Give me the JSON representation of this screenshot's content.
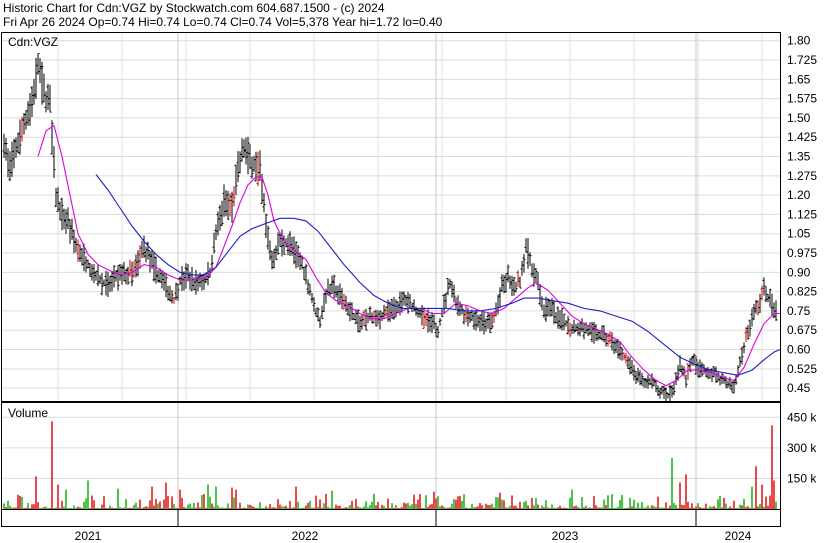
{
  "header": {
    "line1": "Historic Chart for Cdn:VGZ by Stockwatch.com 604.687.1500 - (c) 2024",
    "line2": "Fri Apr 26 2024  Op=0.74  Hi=0.74  Lo=0.74  Cl=0.74  Vol=5,378  Year hi=1.72  lo=0.40"
  },
  "chart_data": [
    {
      "type": "ohlc",
      "title": "Cdn:VGZ",
      "ylim": [
        0.4,
        1.83
      ],
      "yticks": [
        "1.80",
        "1.725",
        "1.65",
        "1.575",
        "1.50",
        "1.425",
        "1.35",
        "1.275",
        "1.20",
        "1.125",
        "1.05",
        "0.975",
        "0.90",
        "0.825",
        "0.75",
        "0.675",
        "0.60",
        "0.525",
        "0.45"
      ],
      "x_labels": [
        "2021",
        "2022",
        "2023",
        "2024"
      ],
      "grid": true,
      "price_anchors": [
        [
          0,
          1.42
        ],
        [
          5,
          1.3
        ],
        [
          10,
          1.36
        ],
        [
          16,
          1.43
        ],
        [
          22,
          1.5
        ],
        [
          28,
          1.57
        ],
        [
          34,
          1.7
        ],
        [
          40,
          1.6
        ],
        [
          46,
          1.55
        ],
        [
          52,
          1.2
        ],
        [
          58,
          1.13
        ],
        [
          64,
          1.1
        ],
        [
          72,
          1.0
        ],
        [
          80,
          0.96
        ],
        [
          88,
          0.91
        ],
        [
          96,
          0.87
        ],
        [
          104,
          0.85
        ],
        [
          112,
          0.88
        ],
        [
          120,
          0.89
        ],
        [
          130,
          0.9
        ],
        [
          140,
          1.0
        ],
        [
          150,
          0.92
        ],
        [
          158,
          0.87
        ],
        [
          166,
          0.82
        ],
        [
          170,
          0.79
        ],
        [
          176,
          0.87
        ],
        [
          184,
          0.89
        ],
        [
          192,
          0.86
        ],
        [
          200,
          0.87
        ],
        [
          206,
          0.9
        ],
        [
          212,
          1.05
        ],
        [
          220,
          1.18
        ],
        [
          228,
          1.16
        ],
        [
          234,
          1.3
        ],
        [
          240,
          1.38
        ],
        [
          248,
          1.33
        ],
        [
          256,
          1.3
        ],
        [
          262,
          1.08
        ],
        [
          268,
          0.95
        ],
        [
          276,
          1.02
        ],
        [
          286,
          1.01
        ],
        [
          294,
          0.96
        ],
        [
          302,
          0.89
        ],
        [
          310,
          0.76
        ],
        [
          316,
          0.71
        ],
        [
          322,
          0.82
        ],
        [
          330,
          0.84
        ],
        [
          340,
          0.79
        ],
        [
          348,
          0.74
        ],
        [
          356,
          0.7
        ],
        [
          364,
          0.73
        ],
        [
          372,
          0.71
        ],
        [
          380,
          0.74
        ],
        [
          390,
          0.76
        ],
        [
          400,
          0.79
        ],
        [
          410,
          0.76
        ],
        [
          420,
          0.72
        ],
        [
          428,
          0.7
        ],
        [
          434,
          0.68
        ],
        [
          440,
          0.77
        ],
        [
          446,
          0.86
        ],
        [
          452,
          0.79
        ],
        [
          460,
          0.74
        ],
        [
          468,
          0.73
        ],
        [
          476,
          0.71
        ],
        [
          484,
          0.7
        ],
        [
          490,
          0.72
        ],
        [
          498,
          0.84
        ],
        [
          504,
          0.88
        ],
        [
          510,
          0.83
        ],
        [
          516,
          0.87
        ],
        [
          522,
          1.0
        ],
        [
          528,
          0.92
        ],
        [
          534,
          0.85
        ],
        [
          540,
          0.75
        ],
        [
          546,
          0.77
        ],
        [
          552,
          0.73
        ],
        [
          560,
          0.71
        ],
        [
          568,
          0.68
        ],
        [
          576,
          0.69
        ],
        [
          584,
          0.67
        ],
        [
          592,
          0.66
        ],
        [
          600,
          0.65
        ],
        [
          608,
          0.63
        ],
        [
          616,
          0.6
        ],
        [
          624,
          0.55
        ],
        [
          632,
          0.5
        ],
        [
          640,
          0.47
        ],
        [
          648,
          0.48
        ],
        [
          656,
          0.44
        ],
        [
          664,
          0.42
        ],
        [
          670,
          0.45
        ],
        [
          676,
          0.55
        ],
        [
          682,
          0.49
        ],
        [
          688,
          0.56
        ],
        [
          694,
          0.53
        ],
        [
          700,
          0.52
        ],
        [
          706,
          0.51
        ],
        [
          712,
          0.5
        ],
        [
          718,
          0.48
        ],
        [
          724,
          0.47
        ],
        [
          730,
          0.45
        ],
        [
          736,
          0.55
        ],
        [
          742,
          0.65
        ],
        [
          748,
          0.72
        ],
        [
          754,
          0.77
        ],
        [
          760,
          0.83
        ],
        [
          766,
          0.79
        ],
        [
          772,
          0.75
        ],
        [
          776,
          0.71
        ]
      ],
      "ma_short_anchors": [
        [
          34,
          1.35
        ],
        [
          42,
          1.45
        ],
        [
          50,
          1.47
        ],
        [
          58,
          1.35
        ],
        [
          66,
          1.2
        ],
        [
          74,
          1.05
        ],
        [
          84,
          0.97
        ],
        [
          94,
          0.93
        ],
        [
          104,
          0.91
        ],
        [
          116,
          0.89
        ],
        [
          128,
          0.9
        ],
        [
          140,
          0.93
        ],
        [
          152,
          0.92
        ],
        [
          164,
          0.89
        ],
        [
          176,
          0.87
        ],
        [
          190,
          0.87
        ],
        [
          202,
          0.88
        ],
        [
          212,
          0.92
        ],
        [
          220,
          1.0
        ],
        [
          228,
          1.08
        ],
        [
          236,
          1.17
        ],
        [
          244,
          1.24
        ],
        [
          252,
          1.27
        ],
        [
          258,
          1.27
        ],
        [
          264,
          1.2
        ],
        [
          270,
          1.1
        ],
        [
          280,
          1.02
        ],
        [
          292,
          0.98
        ],
        [
          302,
          0.95
        ],
        [
          312,
          0.88
        ],
        [
          322,
          0.82
        ],
        [
          332,
          0.79
        ],
        [
          344,
          0.77
        ],
        [
          356,
          0.74
        ],
        [
          368,
          0.72
        ],
        [
          380,
          0.72
        ],
        [
          392,
          0.74
        ],
        [
          404,
          0.76
        ],
        [
          416,
          0.76
        ],
        [
          428,
          0.74
        ],
        [
          440,
          0.74
        ],
        [
          452,
          0.78
        ],
        [
          464,
          0.77
        ],
        [
          476,
          0.75
        ],
        [
          488,
          0.74
        ],
        [
          500,
          0.76
        ],
        [
          512,
          0.8
        ],
        [
          524,
          0.84
        ],
        [
          532,
          0.86
        ],
        [
          544,
          0.83
        ],
        [
          556,
          0.78
        ],
        [
          568,
          0.73
        ],
        [
          580,
          0.7
        ],
        [
          592,
          0.68
        ],
        [
          604,
          0.66
        ],
        [
          616,
          0.63
        ],
        [
          628,
          0.57
        ],
        [
          640,
          0.52
        ],
        [
          652,
          0.48
        ],
        [
          662,
          0.46
        ],
        [
          672,
          0.48
        ],
        [
          684,
          0.52
        ],
        [
          696,
          0.52
        ],
        [
          708,
          0.51
        ],
        [
          720,
          0.49
        ],
        [
          730,
          0.48
        ],
        [
          740,
          0.53
        ],
        [
          750,
          0.62
        ],
        [
          760,
          0.7
        ],
        [
          770,
          0.74
        ],
        [
          776,
          0.74
        ]
      ],
      "ma_long_anchors": [
        [
          92,
          1.28
        ],
        [
          104,
          1.22
        ],
        [
          116,
          1.15
        ],
        [
          128,
          1.08
        ],
        [
          140,
          1.02
        ],
        [
          152,
          0.97
        ],
        [
          164,
          0.93
        ],
        [
          176,
          0.9
        ],
        [
          188,
          0.89
        ],
        [
          200,
          0.89
        ],
        [
          212,
          0.92
        ],
        [
          224,
          0.98
        ],
        [
          236,
          1.04
        ],
        [
          248,
          1.07
        ],
        [
          262,
          1.09
        ],
        [
          276,
          1.11
        ],
        [
          290,
          1.11
        ],
        [
          302,
          1.1
        ],
        [
          314,
          1.06
        ],
        [
          326,
          1.0
        ],
        [
          340,
          0.93
        ],
        [
          356,
          0.86
        ],
        [
          370,
          0.81
        ],
        [
          384,
          0.78
        ],
        [
          398,
          0.76
        ],
        [
          412,
          0.76
        ],
        [
          428,
          0.76
        ],
        [
          444,
          0.76
        ],
        [
          460,
          0.75
        ],
        [
          476,
          0.75
        ],
        [
          492,
          0.76
        ],
        [
          508,
          0.78
        ],
        [
          520,
          0.8
        ],
        [
          534,
          0.8
        ],
        [
          548,
          0.79
        ],
        [
          564,
          0.78
        ],
        [
          580,
          0.76
        ],
        [
          596,
          0.75
        ],
        [
          612,
          0.73
        ],
        [
          628,
          0.71
        ],
        [
          644,
          0.67
        ],
        [
          660,
          0.62
        ],
        [
          676,
          0.57
        ],
        [
          692,
          0.54
        ],
        [
          706,
          0.52
        ],
        [
          720,
          0.51
        ],
        [
          734,
          0.5
        ],
        [
          748,
          0.52
        ],
        [
          760,
          0.56
        ],
        [
          770,
          0.59
        ],
        [
          776,
          0.6
        ]
      ]
    },
    {
      "type": "bar",
      "title": "Volume",
      "ylim": [
        0,
        520000
      ],
      "yticks": [
        "450 k",
        "300 k",
        "150 k"
      ],
      "series": [
        {
          "color": "#00aa00"
        },
        {
          "color": "#dd0000"
        }
      ],
      "spikes": [
        [
          37,
          160000,
          1
        ],
        [
          53,
          430000,
          1
        ],
        [
          59,
          120000,
          1
        ],
        [
          66,
          95000,
          0
        ],
        [
          88,
          140000,
          0
        ],
        [
          118,
          100000,
          0
        ],
        [
          152,
          110000,
          1
        ],
        [
          166,
          130000,
          1
        ],
        [
          180,
          95000,
          1
        ],
        [
          208,
          120000,
          0
        ],
        [
          216,
          110000,
          0
        ],
        [
          232,
          105000,
          1
        ],
        [
          237,
          95000,
          1
        ],
        [
          296,
          110000,
          1
        ],
        [
          332,
          90000,
          0
        ],
        [
          434,
          85000,
          1
        ],
        [
          500,
          80000,
          1
        ],
        [
          573,
          95000,
          0
        ],
        [
          672,
          250000,
          0
        ],
        [
          680,
          130000,
          1
        ],
        [
          686,
          170000,
          1
        ],
        [
          752,
          110000,
          0
        ],
        [
          757,
          210000,
          1
        ],
        [
          763,
          120000,
          1
        ],
        [
          772,
          410000,
          1
        ],
        [
          775,
          140000,
          1
        ]
      ]
    }
  ]
}
